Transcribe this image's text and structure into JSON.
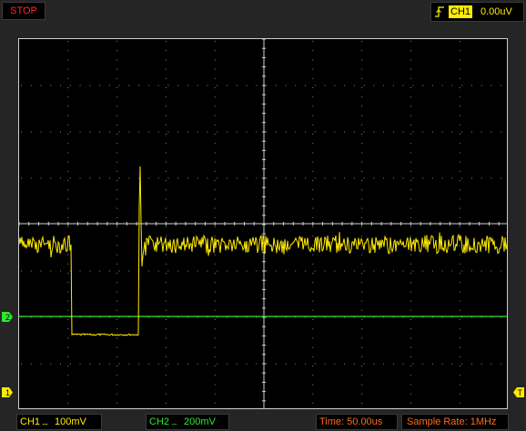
{
  "status": {
    "label": "STOP"
  },
  "trigger": {
    "icon": "rising-edge-trigger-icon",
    "channel": "CH1",
    "level": "0.00uV",
    "color": "#ffeb00"
  },
  "channels": {
    "ch1": {
      "label": "CH1",
      "coupling": "....",
      "volts_per_div": "100mV",
      "color": "#ffeb00"
    },
    "ch2": {
      "label": "CH2",
      "coupling": "....",
      "volts_per_div": "200mV",
      "color": "#2ee82e"
    }
  },
  "markers": {
    "ch1_marker": "1",
    "ch2_marker": "2",
    "trigger_marker": "T"
  },
  "timebase": {
    "label": "Time:",
    "value": "50.00us",
    "display": "Time: 50.00us"
  },
  "sample_rate": {
    "label": "Sample Rate:",
    "value": "1MHz",
    "display": "Sample Rate: 1MHz"
  },
  "grid": {
    "horizontal_divisions": 10,
    "vertical_divisions": 8,
    "grid_color": "#8a8a8a"
  },
  "waveform": {
    "ch1_description": "noisy baseline with a negative rectangular pulse and a spike at its trailing edge",
    "ch2_description": "flat line"
  }
}
